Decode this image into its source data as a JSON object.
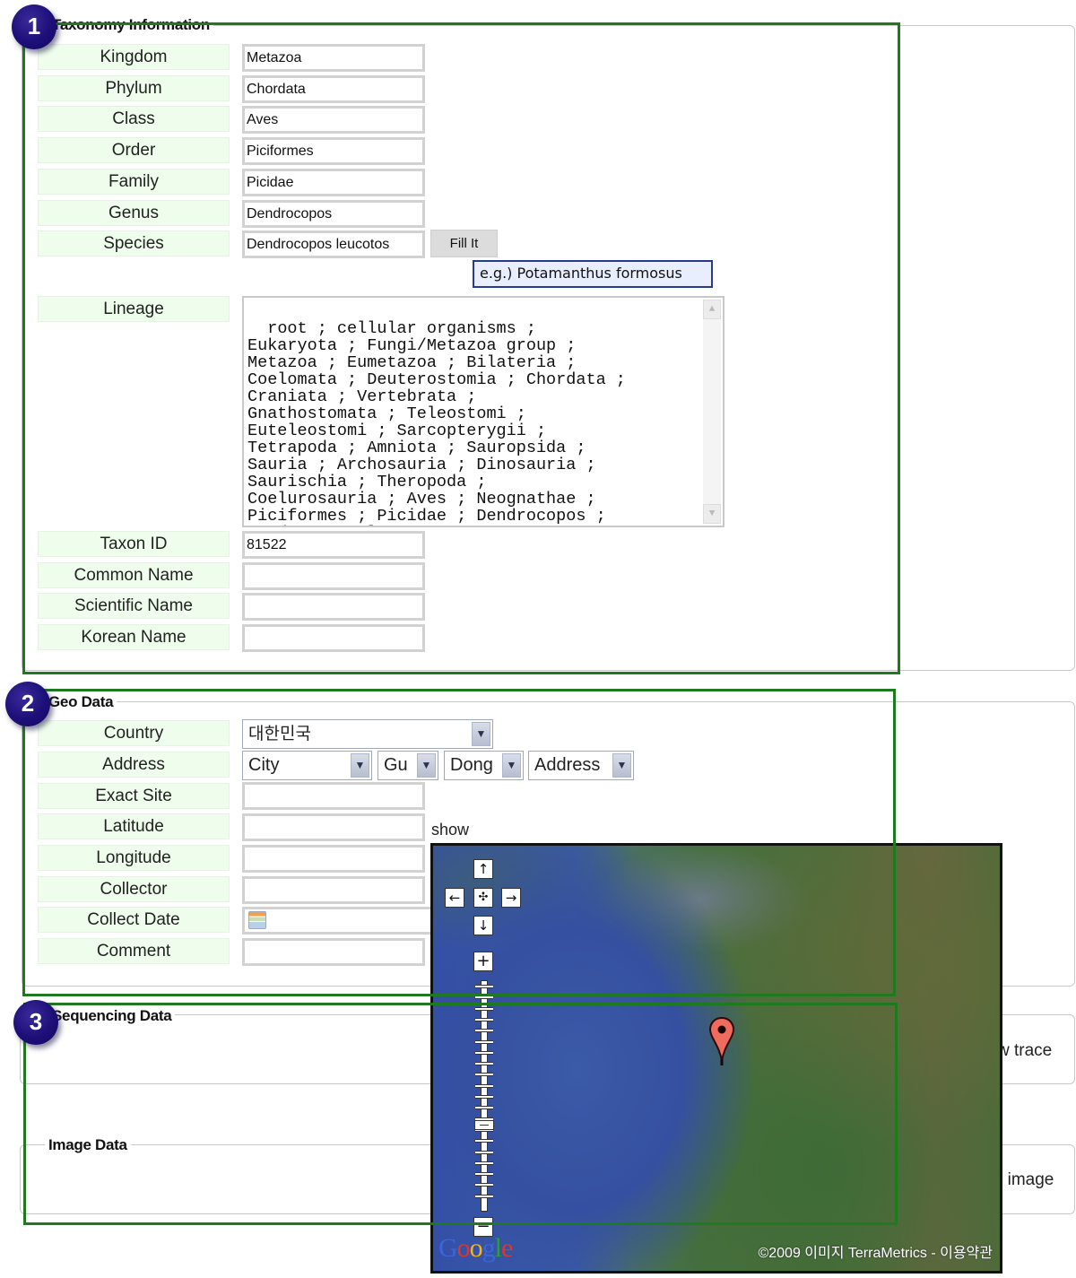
{
  "sections": {
    "taxonomy": {
      "badge": "1",
      "title": "Taxonomy Information"
    },
    "geo": {
      "badge": "2",
      "title": "Geo Data"
    },
    "sequencing": {
      "badge": "3",
      "title": "Sequencing Data",
      "action_partial": "w trace"
    },
    "image": {
      "title": "Image Data",
      "action_partial": "r image"
    }
  },
  "taxonomy_fields": [
    {
      "label": "Kingdom",
      "value": "Metazoa"
    },
    {
      "label": "Phylum",
      "value": "Chordata"
    },
    {
      "label": "Class",
      "value": "Aves"
    },
    {
      "label": "Order",
      "value": "Piciformes"
    },
    {
      "label": "Family",
      "value": "Picidae"
    },
    {
      "label": "Genus",
      "value": "Dendrocopos"
    },
    {
      "label": "Species",
      "value": "Dendrocopos leucotos"
    }
  ],
  "fill_button": "Fill It",
  "species_tooltip": "e.g.) Potamanthus formosus",
  "lineage": {
    "label": "Lineage",
    "value": "root ; cellular organisms ;\nEukaryota ; Fungi/Metazoa group ;\nMetazoa ; Eumetazoa ; Bilateria ;\nCoelomata ; Deuterostomia ; Chordata ;\nCraniata ; Vertebrata ;\nGnathostomata ; Teleostomi ;\nEuteleostomi ; Sarcopterygii ;\nTetrapoda ; Amniota ; Sauropsida ;\nSauria ; Archosauria ; Dinosauria ;\nSaurischia ; Theropoda ;\nCoelurosauria ; Aves ; Neognathae ;\nPiciformes ; Picidae ; Dendrocopos ;\nDendrocopos leucotos"
  },
  "taxonomy_extra_fields": [
    {
      "label": "Taxon ID",
      "value": "81522"
    },
    {
      "label": "Common Name",
      "value": ""
    },
    {
      "label": "Scientific Name",
      "value": ""
    },
    {
      "label": "Korean Name",
      "value": ""
    }
  ],
  "geo_fields": {
    "country": {
      "label": "Country",
      "selected": "대한민국"
    },
    "address": {
      "label": "Address",
      "selects": [
        "City",
        "Gu",
        "Dong",
        "Address"
      ]
    },
    "exact_site": {
      "label": "Exact Site",
      "value": ""
    },
    "latitude": {
      "label": "Latitude",
      "value": ""
    },
    "show_link": "show",
    "longitude": {
      "label": "Longitude",
      "value": ""
    },
    "collector": {
      "label": "Collector",
      "value": ""
    },
    "collect_date": {
      "label": "Collect Date",
      "value": ""
    },
    "comment": {
      "label": "Comment",
      "value": ""
    }
  },
  "map": {
    "logo": "Google",
    "copyright": "©2009 이미지 TerraMetrics - 이용약관",
    "controls": {
      "up": "↑",
      "down": "↓",
      "left": "←",
      "right": "→",
      "center": "✣",
      "zoom_in": "+",
      "zoom_out": "−"
    },
    "zoom_level_fraction": 0.36
  },
  "colors": {
    "highlight_border": "#1f7a1f",
    "badge": "#1d0f78",
    "label_bg": "#effdec",
    "tooltip_bg": "#e9eefe",
    "marker": "#f06a5e"
  }
}
